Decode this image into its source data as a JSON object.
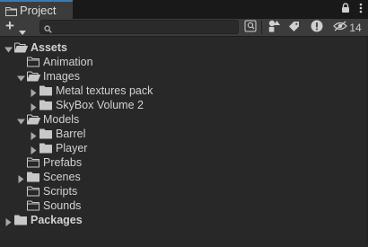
{
  "window": {
    "tab_title": "Project",
    "colors": {
      "tab_accent": "#3a79bb",
      "background": "#282828",
      "toolbar": "#3c3c3c"
    }
  },
  "toolbar": {
    "add_label": "+",
    "search": {
      "value": "",
      "placeholder": ""
    },
    "hidden_count": "14",
    "icons": [
      "search-by-type-icon",
      "search-by-label-icon",
      "show-errors-icon",
      "hidden-packages-icon"
    ]
  },
  "tree": [
    {
      "id": "assets",
      "label": "Assets",
      "depth": 0,
      "expanded": true,
      "has_children": true,
      "bold": true
    },
    {
      "id": "animation",
      "label": "Animation",
      "depth": 1,
      "expanded": false,
      "has_children": false
    },
    {
      "id": "images",
      "label": "Images",
      "depth": 1,
      "expanded": true,
      "has_children": true
    },
    {
      "id": "metal-textures-pack",
      "label": "Metal textures pack",
      "depth": 2,
      "expanded": false,
      "has_children": true
    },
    {
      "id": "skybox-volume-2",
      "label": "SkyBox Volume 2",
      "depth": 2,
      "expanded": false,
      "has_children": true
    },
    {
      "id": "models",
      "label": "Models",
      "depth": 1,
      "expanded": true,
      "has_children": true
    },
    {
      "id": "barrel",
      "label": "Barrel",
      "depth": 2,
      "expanded": false,
      "has_children": true
    },
    {
      "id": "player",
      "label": "Player",
      "depth": 2,
      "expanded": false,
      "has_children": true
    },
    {
      "id": "prefabs",
      "label": "Prefabs",
      "depth": 1,
      "expanded": false,
      "has_children": false
    },
    {
      "id": "scenes",
      "label": "Scenes",
      "depth": 1,
      "expanded": false,
      "has_children": true
    },
    {
      "id": "scripts",
      "label": "Scripts",
      "depth": 1,
      "expanded": false,
      "has_children": false
    },
    {
      "id": "sounds",
      "label": "Sounds",
      "depth": 1,
      "expanded": false,
      "has_children": false
    },
    {
      "id": "packages",
      "label": "Packages",
      "depth": 0,
      "expanded": false,
      "has_children": true,
      "bold": true
    }
  ]
}
